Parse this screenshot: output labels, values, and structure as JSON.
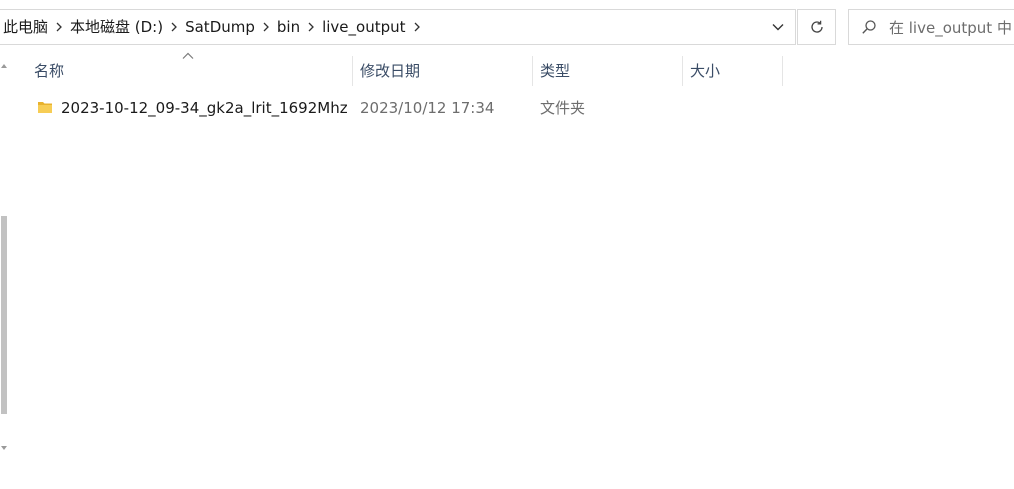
{
  "address_bar": {
    "crumbs": [
      "此电脑",
      "本地磁盘 (D:)",
      "SatDump",
      "bin",
      "live_output"
    ]
  },
  "search": {
    "placeholder": "在 live_output 中"
  },
  "columns": {
    "name": "名称",
    "modified": "修改日期",
    "type": "类型",
    "size": "大小"
  },
  "files": [
    {
      "name": "2023-10-12_09-34_gk2a_lrit_1692Mhz",
      "modified": "2023/10/12 17:34",
      "type": "文件夹",
      "icon": "folder-icon"
    }
  ],
  "colors": {
    "border": "#d9d9d9",
    "header_text": "#3a4c66",
    "folder": "#f5c242"
  }
}
